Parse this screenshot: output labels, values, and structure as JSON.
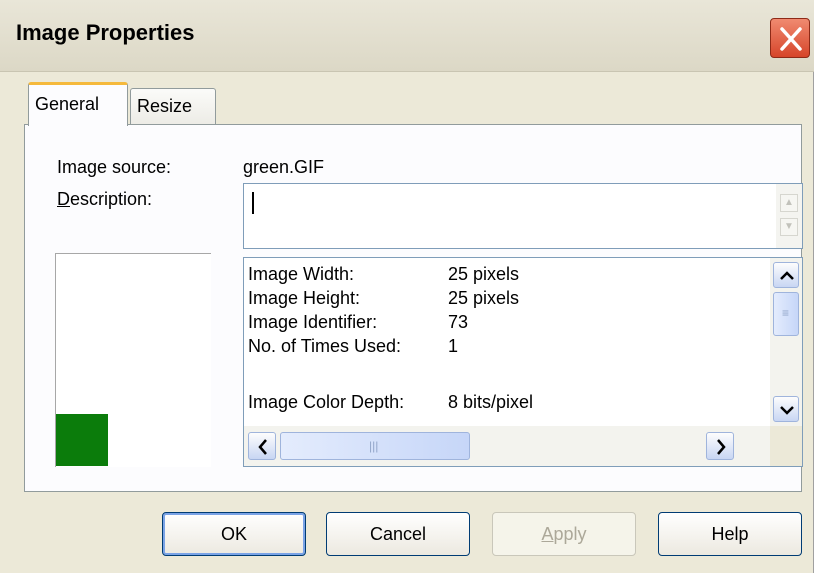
{
  "window": {
    "title": "Image Properties",
    "close_icon": "close-icon"
  },
  "tabs": [
    {
      "label": "General",
      "active": true
    },
    {
      "label": "Resize",
      "active": false
    }
  ],
  "general": {
    "image_source_label": "Image source:",
    "image_source_value": "green.GIF",
    "description_label_accel": "D",
    "description_label_rest": "escription:",
    "description_value": "",
    "preview_color": "#0b7c0b",
    "info": [
      {
        "key": "Image Width:",
        "value": "25 pixels"
      },
      {
        "key": "Image Height:",
        "value": "25 pixels"
      },
      {
        "key": "Image Identifier:",
        "value": "73"
      },
      {
        "key": "No. of Times Used:",
        "value": "1"
      },
      {
        "key": "Image Color Depth:",
        "value": "8 bits/pixel"
      }
    ]
  },
  "buttons": {
    "ok": "OK",
    "cancel": "Cancel",
    "apply_accel": "A",
    "apply_rest": "pply",
    "help": "Help"
  },
  "colors": {
    "dialog_bg": "#ece9d8",
    "active_tab_accent": "#f5b93c",
    "close_button": "#d6452a"
  }
}
